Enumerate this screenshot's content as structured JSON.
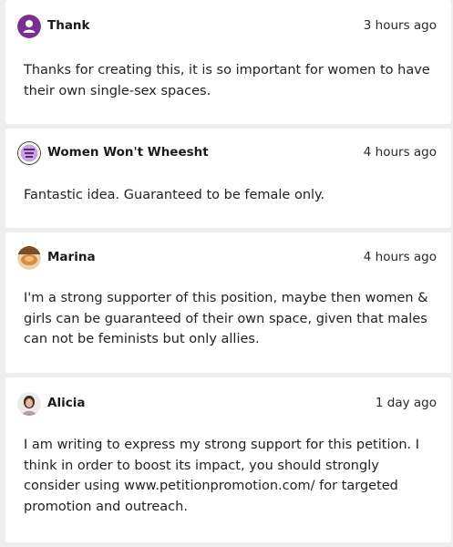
{
  "comments": [
    {
      "author": "Thank",
      "time": "3 hours ago",
      "text": "Thanks for creating this, it is so important for women to have their own single-sex spaces.",
      "avatar_icon": "default-user-icon",
      "avatar_color": "#7a2e8f"
    },
    {
      "author": "Women Won't Wheesht",
      "time": "4 hours ago",
      "text": "Fantastic idea. Guaranteed to be female only.",
      "avatar_icon": "group-logo-avatar",
      "avatar_color": "#b68bd1"
    },
    {
      "author": "Marina",
      "time": "4 hours ago",
      "text": "I'm a strong supporter of this position, maybe then women & girls can be guaranteed of their own space, given that males can not be feminists but only allies.",
      "avatar_icon": "photo-avatar",
      "avatar_color": "#c97d3a"
    },
    {
      "author": "Alicia",
      "time": "1 day ago",
      "text": "I am writing to express my strong support for this petition. I think in order to boost its impact, you should strongly consider using www.petitionpromotion.com/ for targeted promotion and outreach.",
      "avatar_icon": "photo-avatar",
      "avatar_color": "#b89a88"
    }
  ]
}
